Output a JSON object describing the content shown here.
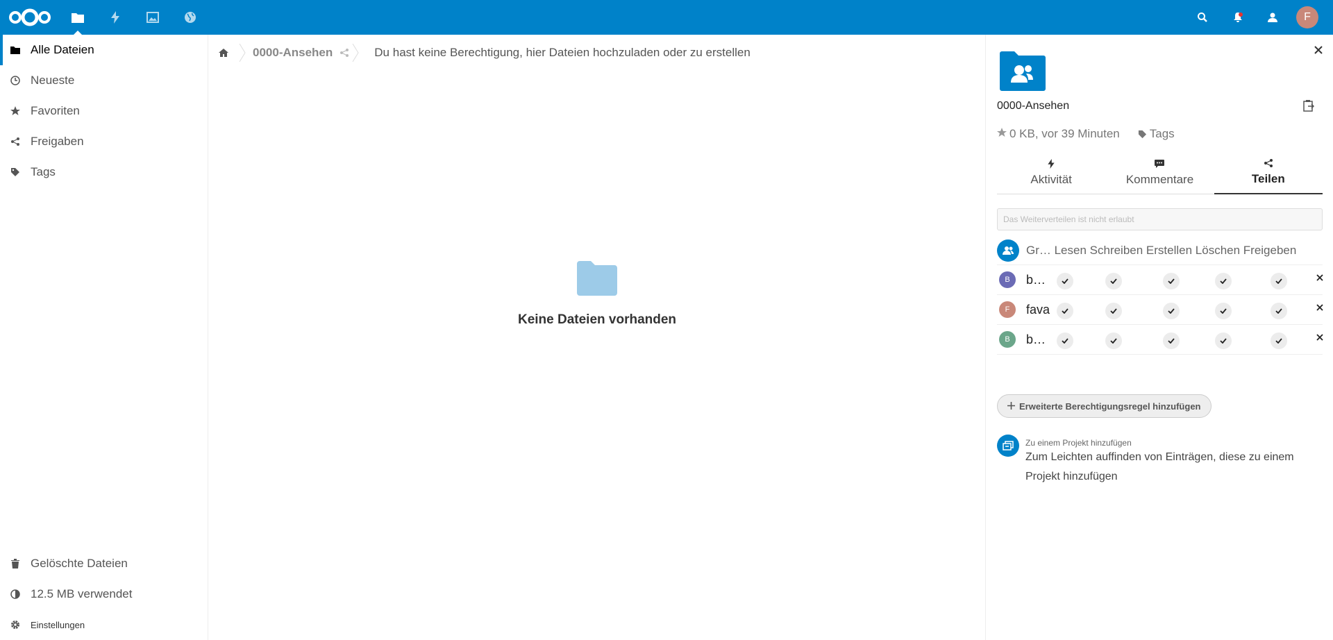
{
  "header": {
    "apps": [
      "files-icon",
      "activity-icon",
      "photos-icon",
      "circles-icon"
    ],
    "right_icons": [
      "search-icon",
      "notifications-icon",
      "contacts-icon"
    ],
    "user_initial": "F",
    "accent": "#0082c9"
  },
  "sidebar": {
    "items": [
      {
        "label": "Alle Dateien",
        "icon": "folder-icon",
        "active": true
      },
      {
        "label": "Neueste",
        "icon": "clock-icon"
      },
      {
        "label": "Favoriten",
        "icon": "star-icon"
      },
      {
        "label": "Freigaben",
        "icon": "share-icon"
      },
      {
        "label": "Tags",
        "icon": "tag-icon"
      }
    ],
    "bottom": [
      {
        "label": "Gelöschte Dateien",
        "icon": "trash-icon"
      },
      {
        "label": "12.5 MB verwendet",
        "icon": "quota-icon"
      },
      {
        "label": "Einstellungen",
        "icon": "gear-icon"
      }
    ]
  },
  "breadcrumb": {
    "folder": "0000-Ansehen",
    "message": "Du hast keine Berechtigung, hier Dateien hochzuladen oder zu erstellen"
  },
  "empty": {
    "title": "Keine Dateien vorhanden"
  },
  "details": {
    "name": "0000-Ansehen",
    "meta": "0 KB, vor 39 Minuten",
    "tags_label": "Tags",
    "tabs": [
      {
        "label": "Aktivität",
        "icon": "activity-icon"
      },
      {
        "label": "Kommentare",
        "icon": "comment-icon"
      },
      {
        "label": "Teilen",
        "icon": "share-icon",
        "active": true
      }
    ],
    "share_placeholder": "Das Weiterverteilen ist nicht erlaubt",
    "perm_header": "Gr… Lesen Schreiben Erstellen Löschen Freigeben",
    "rows": [
      {
        "name": "b…",
        "initial": "B",
        "color": "#6b6bb5"
      },
      {
        "name": "fava",
        "initial": "F",
        "color": "#c98879"
      },
      {
        "name": "b…",
        "initial": "B",
        "color": "#6ba68a"
      }
    ],
    "add_rule": "Erweiterte Berechtigungsregel hinzufügen",
    "project_title": "Zu einem Projekt hinzufügen",
    "project_desc": "Zum Leichten auffinden von Einträgen, diese zu einem Projekt hinzufügen"
  }
}
